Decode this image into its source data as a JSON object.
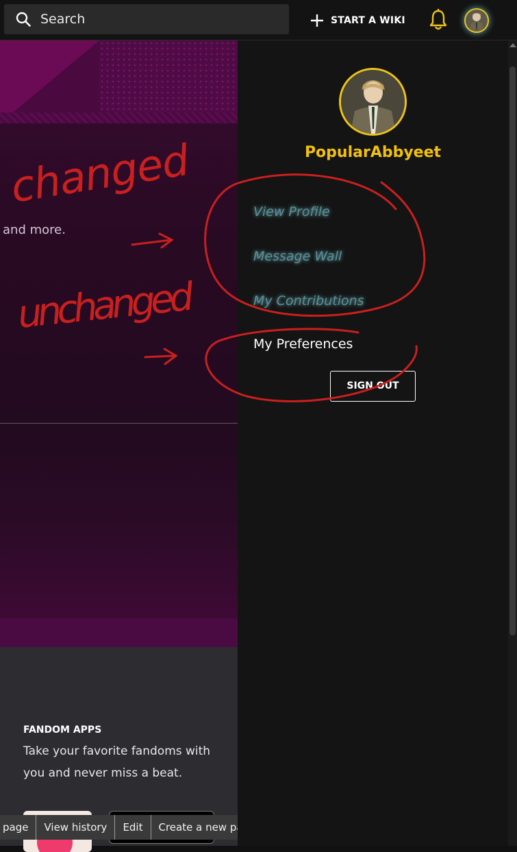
{
  "topbar": {
    "search_placeholder": "Search",
    "start_wiki_label": "START A WIKI",
    "icons": [
      "search-icon",
      "plus-icon",
      "bell-icon",
      "avatar"
    ]
  },
  "page": {
    "partial_text": "and more."
  },
  "footer": {
    "apps_heading": "FANDOM APPS",
    "apps_text": "Take your favorite fandoms with you and never miss a beat."
  },
  "bottom_toolbar": {
    "items": [
      "page",
      "View history",
      "Edit",
      "Create a new pag"
    ]
  },
  "user_panel": {
    "username": "PopularAbbyeet",
    "menu": {
      "view_profile": "View Profile",
      "message_wall": "Message Wall",
      "my_contributions": "My Contributions",
      "my_preferences": "My Preferences"
    },
    "sign_out": "SIGN OUT"
  },
  "annotations": {
    "changed": "changed",
    "unchanged": "unchanged"
  },
  "colors": {
    "accent_yellow": "#f2c10f",
    "glow_text": "#5b8f98",
    "annotation_red": "#c8201f",
    "panel_bg": "#141414"
  }
}
